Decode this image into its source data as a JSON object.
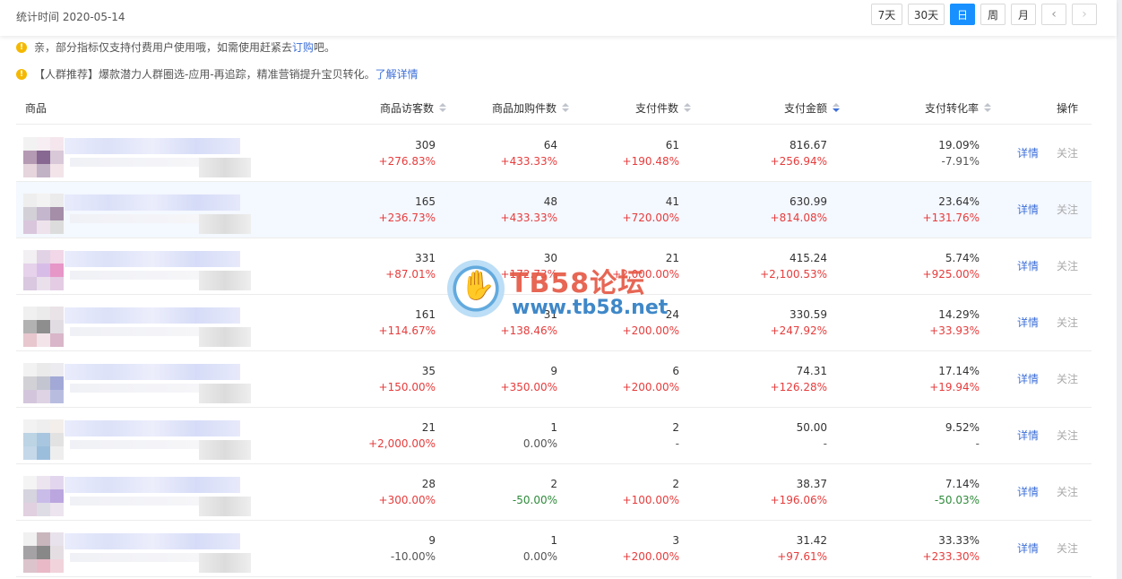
{
  "header": {
    "stat_time": "统计时间 2020-05-14",
    "buttons": [
      "7天",
      "30天",
      "日",
      "周",
      "月"
    ],
    "active": "日",
    "prev": "‹",
    "next": "›"
  },
  "notices": [
    {
      "before": "亲，部分指标仅支持付费用户使用哦，如需使用赶紧去 ",
      "link": "订购",
      "after": "吧。"
    },
    {
      "before": "【人群推荐】爆款潜力人群圈选-应用-再追踪，精准营销提升宝贝转化。",
      "link": "了解详情",
      "after": ""
    }
  ],
  "table": {
    "columns": [
      "商品",
      "商品访客数",
      "商品加购件数",
      "支付件数",
      "支付金额",
      "支付转化率",
      "操作"
    ],
    "sorted_column": "支付金额",
    "rows": [
      {
        "visitors": "309",
        "visitors_chg": "+276.83%",
        "addcart": "64",
        "addcart_chg": "+433.33%",
        "paid": "61",
        "paid_chg": "+190.48%",
        "amount": "816.67",
        "amount_chg": "+256.94%",
        "conv": "19.09%",
        "conv_chg": "-7.91%"
      },
      {
        "visitors": "165",
        "visitors_chg": "+236.73%",
        "addcart": "48",
        "addcart_chg": "+433.33%",
        "paid": "41",
        "paid_chg": "+720.00%",
        "amount": "630.99",
        "amount_chg": "+814.08%",
        "conv": "23.64%",
        "conv_chg": "+131.76%"
      },
      {
        "visitors": "331",
        "visitors_chg": "+87.01%",
        "addcart": "30",
        "addcart_chg": "+172.73%",
        "paid": "21",
        "paid_chg": "+2,000.00%",
        "amount": "415.24",
        "amount_chg": "+2,100.53%",
        "conv": "5.74%",
        "conv_chg": "+925.00%"
      },
      {
        "visitors": "161",
        "visitors_chg": "+114.67%",
        "addcart": "31",
        "addcart_chg": "+138.46%",
        "paid": "24",
        "paid_chg": "+200.00%",
        "amount": "330.59",
        "amount_chg": "+247.92%",
        "conv": "14.29%",
        "conv_chg": "+33.93%"
      },
      {
        "visitors": "35",
        "visitors_chg": "+150.00%",
        "addcart": "9",
        "addcart_chg": "+350.00%",
        "paid": "6",
        "paid_chg": "+200.00%",
        "amount": "74.31",
        "amount_chg": "+126.28%",
        "conv": "17.14%",
        "conv_chg": "+19.94%"
      },
      {
        "visitors": "21",
        "visitors_chg": "+2,000.00%",
        "addcart": "1",
        "addcart_chg": "0.00%",
        "paid": "2",
        "paid_chg": "-",
        "amount": "50.00",
        "amount_chg": "-",
        "conv": "9.52%",
        "conv_chg": "-"
      },
      {
        "visitors": "28",
        "visitors_chg": "+300.00%",
        "addcart": "2",
        "addcart_chg": "-50.00%",
        "paid": "2",
        "paid_chg": "+100.00%",
        "amount": "38.37",
        "amount_chg": "+196.06%",
        "conv": "7.14%",
        "conv_chg": "-50.03%"
      },
      {
        "visitors": "9",
        "visitors_chg": "-10.00%",
        "addcart": "1",
        "addcart_chg": "0.00%",
        "paid": "3",
        "paid_chg": "+200.00%",
        "amount": "31.42",
        "amount_chg": "+97.61%",
        "conv": "33.33%",
        "conv_chg": "+233.30%"
      }
    ],
    "action_detail": "详情",
    "action_follow": "关注"
  },
  "watermark": {
    "line1": "TB58论坛",
    "line2": "www.tb58.net",
    "icon": "hand-icon"
  },
  "colors": {
    "accent": "#1890ff",
    "link": "#3d6fd8",
    "up": "#e63c3c",
    "down": "#2e8b3a",
    "notice": "#f5b800"
  },
  "thumb_colors": [
    [
      "#f2f2f2",
      "#f6eef2",
      "#f4e6ec",
      "#b59ab4",
      "#876892",
      "#d8c8d8",
      "#e6d5dd",
      "#c2b2c6",
      "#f3e4ea"
    ],
    [
      "#eeeeee",
      "#f3f3f3",
      "#ebebeb",
      "#d3d0d8",
      "#c4b6cd",
      "#a48ea8",
      "#d9c6dc",
      "#eee2ec",
      "#dcdcdc"
    ],
    [
      "#f2f0f2",
      "#e2d2e6",
      "#f1d7e7",
      "#e6d2ea",
      "#d8bce8",
      "#e796c8",
      "#d9c8e0",
      "#eae0ec",
      "#e4cce4"
    ],
    [
      "#f0f0f0",
      "#ebebeb",
      "#e9e2e7",
      "#b2b2b2",
      "#8e8e8e",
      "#e1dce2",
      "#e8c7cf",
      "#f2e4e9",
      "#d9b6c9"
    ],
    [
      "#f2f2f2",
      "#eaeaea",
      "#ebebf0",
      "#d2d2d6",
      "#c3c6d0",
      "#a2a9d6",
      "#d3c6dc",
      "#ddd3e4",
      "#b8bde0"
    ],
    [
      "#f2f2f2",
      "#eeeeee",
      "#f3eeea",
      "#bcd4e4",
      "#a8c6df",
      "#e2e2e2",
      "#c4d8ea",
      "#9cbedd",
      "#eeeeee"
    ],
    [
      "#f4f4f4",
      "#ece4ee",
      "#e2d6ee",
      "#d6d4de",
      "#c9bce8",
      "#bba6df",
      "#e1d0e0",
      "#dedde6",
      "#ece4ee"
    ],
    [
      "#f1f1f1",
      "#c9b6bc",
      "#e8e2ec",
      "#a4a2a4",
      "#888888",
      "#e4dee2",
      "#dcc4cc",
      "#e9b9c8",
      "#f1d3dc"
    ]
  ]
}
